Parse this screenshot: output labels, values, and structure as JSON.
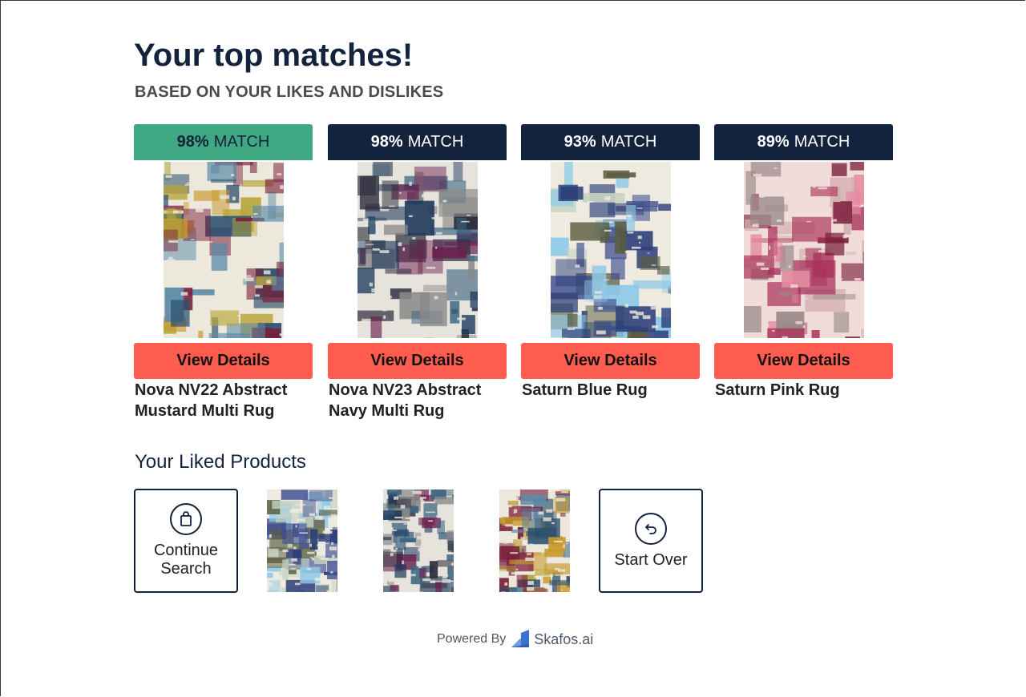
{
  "page": {
    "title": "Your top matches!",
    "subtitle": "BASED ON YOUR LIKES AND DISLIKES"
  },
  "matches": [
    {
      "percent": "98%",
      "match_label": "MATCH",
      "button": "View Details",
      "name_line1": "Nova NV22 Abstract",
      "name_line2": "Mustard Multi Rug",
      "top": true,
      "palette": [
        "#ece8dc",
        "#b9a53c",
        "#7a1f3a",
        "#2b4f6e",
        "#c99a2e",
        "#5c8aa8"
      ]
    },
    {
      "percent": "98%",
      "match_label": "MATCH",
      "button": "View Details",
      "name_line1": "Nova NV23 Abstract",
      "name_line2": "Navy Multi Rug",
      "top": false,
      "palette": [
        "#e6e3dc",
        "#6b1f4f",
        "#1f3a5c",
        "#3d6480",
        "#8a8a8a",
        "#2d2d3d"
      ]
    },
    {
      "percent": "93%",
      "match_label": "MATCH",
      "button": "View Details",
      "name_line1": "Saturn Blue Rug",
      "name_line2": "",
      "top": false,
      "palette": [
        "#eeeae0",
        "#8ec9e8",
        "#5a5d3f",
        "#3f4f8f",
        "#2d3f7a",
        "#c5d3c0"
      ]
    },
    {
      "percent": "89%",
      "match_label": "MATCH",
      "button": "View Details",
      "name_line1": "Saturn Pink Rug",
      "name_line2": "",
      "top": false,
      "palette": [
        "#f0dcd8",
        "#e48aa0",
        "#a9325a",
        "#7a1f3c",
        "#d2b0b0",
        "#9a8a8a"
      ]
    }
  ],
  "liked": {
    "title": "Your Liked Products",
    "continue_label_1": "Continue",
    "continue_label_2": "Search",
    "start_over_label": "Start Over",
    "thumbnails": [
      {
        "alt": "Saturn Blue Rug thumbnail",
        "palette": [
          "#eeeae0",
          "#8ec9e8",
          "#5a5d3f",
          "#3f4f8f",
          "#2d3f7a",
          "#c5d3c0"
        ]
      },
      {
        "alt": "Nova NV23 Abstract Navy Multi Rug thumbnail",
        "palette": [
          "#e6e3dc",
          "#6b1f4f",
          "#1f3a5c",
          "#3d6480",
          "#8a8a8a",
          "#2d2d3d"
        ]
      },
      {
        "alt": "Nova NV22 Abstract Mustard Multi Rug thumbnail",
        "palette": [
          "#ece8dc",
          "#b9a53c",
          "#7a1f3a",
          "#2b4f6e",
          "#c99a2e",
          "#5c8aa8"
        ]
      }
    ]
  },
  "footer": {
    "powered_by": "Powered By",
    "brand": "Skafos.ai"
  },
  "colors": {
    "navy": "#13223d",
    "green": "#3fa882",
    "coral": "#ff5c50"
  }
}
